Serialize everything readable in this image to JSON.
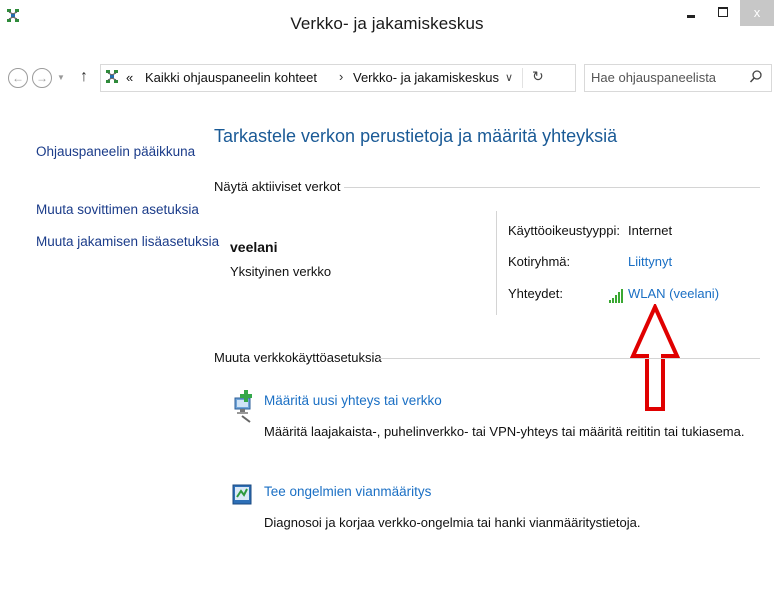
{
  "window": {
    "title": "Verkko- ja jakamiskeskus",
    "close_glyph": "x",
    "app_icon": "network-center-icon"
  },
  "nav": {
    "back_glyph": "←",
    "forward_glyph": "→",
    "recent_glyph": "▼",
    "up_glyph": "↑",
    "address_prefix": "«",
    "breadcrumb": [
      "Kaikki ohjauspaneelin kohteet",
      "Verkko- ja jakamiskeskus"
    ],
    "breadcrumb_separator": "›",
    "dropdown_glyph": "∨",
    "refresh_glyph": "↻",
    "search_placeholder": "Hae ohjauspaneelista"
  },
  "sidebar": {
    "items": [
      "Ohjauspaneelin pääikkuna",
      "Muuta sovittimen asetuksia",
      "Muuta jakamisen lisäasetuksia"
    ]
  },
  "main": {
    "title": "Tarkastele verkon perustietoja ja määritä yhteyksiä",
    "active_header": "Näytä aktiiviset verkot",
    "network": {
      "name": "veelani",
      "type": "Yksityinen verkko",
      "access_label": "Käyttöoikeustyyppi:",
      "access_value": "Internet",
      "homegroup_label": "Kotiryhmä:",
      "homegroup_value": "Liittynyt",
      "connections_label": "Yhteydet:",
      "connections_value": "WLAN (veelani)"
    },
    "change_header": "Muuta verkkokäyttöasetuksia",
    "tasks": [
      {
        "link": "Määritä uusi yhteys tai verkko",
        "desc": "Määritä laajakaista-, puhelinverkko- tai VPN-yhteys tai määritä reititin tai tukiasema.",
        "icon": "new-connection-icon"
      },
      {
        "link": "Tee ongelmien vianmääritys",
        "desc": "Diagnosoi ja korjaa verkko-ongelmia tai hanki vianmääritystietoja.",
        "icon": "troubleshoot-icon"
      }
    ]
  },
  "colors": {
    "link": "#1a6fc4",
    "title": "#1a5a96",
    "sidebar_link": "#1b3c8a",
    "annotation_arrow": "#e00000",
    "signal": "#3aa832"
  }
}
